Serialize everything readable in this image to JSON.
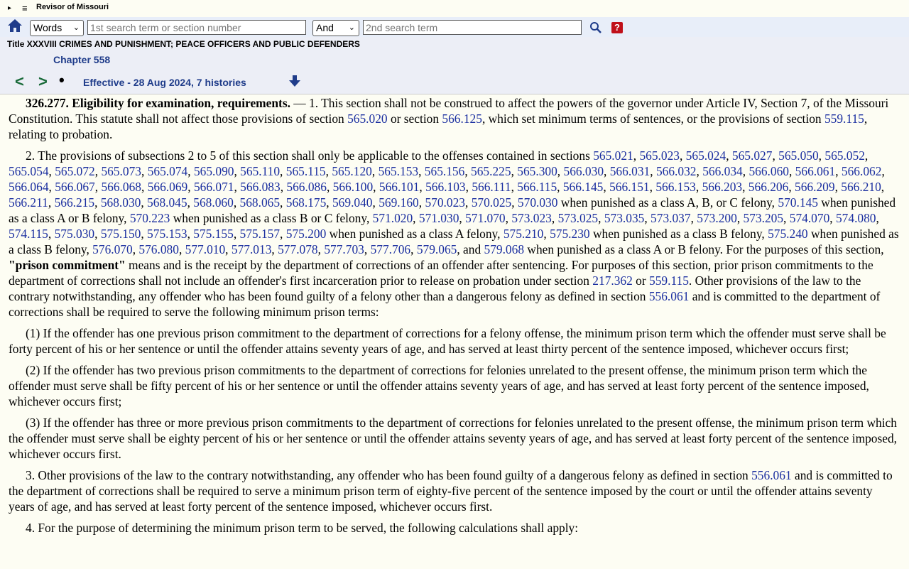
{
  "topbar": {
    "brand": "Revisor of Missouri",
    "triangle": "▸",
    "menu": "≡"
  },
  "search": {
    "mode_selected": "Words",
    "term1_placeholder": "1st search term or section number",
    "connector_selected": "And",
    "term2_placeholder": "2nd search term",
    "help_label": "?"
  },
  "header": {
    "title": "Title XXXVIII CRIMES AND PUNISHMENT; PEACE OFFICERS AND PUBLIC DEFENDERS",
    "chapter": "Chapter 558",
    "prev": "<",
    "next": ">",
    "dot": "•",
    "effective": "Effective - 28 Aug 2024, 7 histories"
  },
  "icons": {
    "home": "home-icon",
    "search": "search-icon",
    "help": "help-icon",
    "down": "down-arrow-icon"
  },
  "colors": {
    "link": "#1b2fa0",
    "chapter": "#1f3c8a",
    "nav": "#1a6b3a",
    "help_bg": "#c0101a"
  },
  "section": {
    "number": "326.277.",
    "heading": "Eligibility for examination, requirements.",
    "p1": [
      {
        "t": " — 1.  This section shall not be construed to affect the powers of the governor under Article IV, Section 7, of the Missouri Constitution.  This statute shall not affect those provisions of section "
      },
      {
        "t": "565.020",
        "link": true
      },
      {
        "t": " or section "
      },
      {
        "t": "566.125",
        "link": true
      },
      {
        "t": ", which set minimum terms of sentences, or the provisions of section "
      },
      {
        "t": "559.115",
        "link": true
      },
      {
        "t": ", relating to probation."
      }
    ],
    "p2": [
      {
        "t": "2.  The provisions of subsections 2 to 5 of this section shall only be applicable to the offenses contained in sections "
      },
      {
        "t": "565.021",
        "link": true
      },
      {
        "t": ", "
      },
      {
        "t": "565.023",
        "link": true
      },
      {
        "t": ", "
      },
      {
        "t": "565.024",
        "link": true
      },
      {
        "t": ", "
      },
      {
        "t": "565.027",
        "link": true
      },
      {
        "t": ", "
      },
      {
        "t": "565.050",
        "link": true
      },
      {
        "t": ", "
      },
      {
        "t": "565.052",
        "link": true
      },
      {
        "t": ", "
      },
      {
        "t": "565.054",
        "link": true
      },
      {
        "t": ", "
      },
      {
        "t": "565.072",
        "link": true
      },
      {
        "t": ", "
      },
      {
        "t": "565.073",
        "link": true
      },
      {
        "t": ", "
      },
      {
        "t": "565.074",
        "link": true
      },
      {
        "t": ", "
      },
      {
        "t": "565.090",
        "link": true
      },
      {
        "t": ", "
      },
      {
        "t": "565.110",
        "link": true
      },
      {
        "t": ", "
      },
      {
        "t": "565.115",
        "link": true
      },
      {
        "t": ", "
      },
      {
        "t": "565.120",
        "link": true
      },
      {
        "t": ", "
      },
      {
        "t": "565.153",
        "link": true
      },
      {
        "t": ", "
      },
      {
        "t": "565.156",
        "link": true
      },
      {
        "t": ", "
      },
      {
        "t": "565.225",
        "link": true
      },
      {
        "t": ", "
      },
      {
        "t": "565.300",
        "link": true
      },
      {
        "t": ", "
      },
      {
        "t": "566.030",
        "link": true
      },
      {
        "t": ", "
      },
      {
        "t": "566.031",
        "link": true
      },
      {
        "t": ", "
      },
      {
        "t": "566.032",
        "link": true
      },
      {
        "t": ", "
      },
      {
        "t": "566.034",
        "link": true
      },
      {
        "t": ", "
      },
      {
        "t": "566.060",
        "link": true
      },
      {
        "t": ", "
      },
      {
        "t": "566.061",
        "link": true
      },
      {
        "t": ", "
      },
      {
        "t": "566.062",
        "link": true
      },
      {
        "t": ", "
      },
      {
        "t": "566.064",
        "link": true
      },
      {
        "t": ", "
      },
      {
        "t": "566.067",
        "link": true
      },
      {
        "t": ", "
      },
      {
        "t": "566.068",
        "link": true
      },
      {
        "t": ", "
      },
      {
        "t": "566.069",
        "link": true
      },
      {
        "t": ", "
      },
      {
        "t": "566.071",
        "link": true
      },
      {
        "t": ", "
      },
      {
        "t": "566.083",
        "link": true
      },
      {
        "t": ", "
      },
      {
        "t": "566.086",
        "link": true
      },
      {
        "t": ", "
      },
      {
        "t": "566.100",
        "link": true
      },
      {
        "t": ", "
      },
      {
        "t": "566.101",
        "link": true
      },
      {
        "t": ", "
      },
      {
        "t": "566.103",
        "link": true
      },
      {
        "t": ", "
      },
      {
        "t": "566.111",
        "link": true
      },
      {
        "t": ", "
      },
      {
        "t": "566.115",
        "link": true
      },
      {
        "t": ", "
      },
      {
        "t": "566.145",
        "link": true
      },
      {
        "t": ", "
      },
      {
        "t": "566.151",
        "link": true
      },
      {
        "t": ", "
      },
      {
        "t": "566.153",
        "link": true
      },
      {
        "t": ", "
      },
      {
        "t": "566.203",
        "link": true
      },
      {
        "t": ", "
      },
      {
        "t": "566.206",
        "link": true
      },
      {
        "t": ", "
      },
      {
        "t": "566.209",
        "link": true
      },
      {
        "t": ", "
      },
      {
        "t": "566.210",
        "link": true
      },
      {
        "t": ", "
      },
      {
        "t": "566.211",
        "link": true
      },
      {
        "t": ", "
      },
      {
        "t": "566.215",
        "link": true
      },
      {
        "t": ", "
      },
      {
        "t": "568.030",
        "link": true
      },
      {
        "t": ", "
      },
      {
        "t": "568.045",
        "link": true
      },
      {
        "t": ", "
      },
      {
        "t": "568.060",
        "link": true
      },
      {
        "t": ", "
      },
      {
        "t": "568.065",
        "link": true
      },
      {
        "t": ", "
      },
      {
        "t": "568.175",
        "link": true
      },
      {
        "t": ", "
      },
      {
        "t": "569.040",
        "link": true
      },
      {
        "t": ", "
      },
      {
        "t": "569.160",
        "link": true
      },
      {
        "t": ", "
      },
      {
        "t": "570.023",
        "link": true
      },
      {
        "t": ", "
      },
      {
        "t": "570.025",
        "link": true
      },
      {
        "t": ", "
      },
      {
        "t": "570.030",
        "link": true
      },
      {
        "t": " when punished as a class A, B, or C felony, "
      },
      {
        "t": "570.145",
        "link": true
      },
      {
        "t": " when punished as a class A or B felony, "
      },
      {
        "t": "570.223",
        "link": true
      },
      {
        "t": " when punished as a class B or C felony, "
      },
      {
        "t": "571.020",
        "link": true
      },
      {
        "t": ", "
      },
      {
        "t": "571.030",
        "link": true
      },
      {
        "t": ", "
      },
      {
        "t": "571.070",
        "link": true
      },
      {
        "t": ", "
      },
      {
        "t": "573.023",
        "link": true
      },
      {
        "t": ", "
      },
      {
        "t": "573.025",
        "link": true
      },
      {
        "t": ", "
      },
      {
        "t": "573.035",
        "link": true
      },
      {
        "t": ", "
      },
      {
        "t": "573.037",
        "link": true
      },
      {
        "t": ", "
      },
      {
        "t": "573.200",
        "link": true
      },
      {
        "t": ", "
      },
      {
        "t": "573.205",
        "link": true
      },
      {
        "t": ", "
      },
      {
        "t": "574.070",
        "link": true
      },
      {
        "t": ", "
      },
      {
        "t": "574.080",
        "link": true
      },
      {
        "t": ", "
      },
      {
        "t": "574.115",
        "link": true
      },
      {
        "t": ", "
      },
      {
        "t": "575.030",
        "link": true
      },
      {
        "t": ", "
      },
      {
        "t": "575.150",
        "link": true
      },
      {
        "t": ", "
      },
      {
        "t": "575.153",
        "link": true
      },
      {
        "t": ", "
      },
      {
        "t": "575.155",
        "link": true
      },
      {
        "t": ", "
      },
      {
        "t": "575.157",
        "link": true
      },
      {
        "t": ", "
      },
      {
        "t": "575.200",
        "link": true
      },
      {
        "t": " when punished as a class A felony, "
      },
      {
        "t": "575.210",
        "link": true
      },
      {
        "t": ", "
      },
      {
        "t": "575.230",
        "link": true
      },
      {
        "t": " when punished as a class B felony, "
      },
      {
        "t": "575.240",
        "link": true
      },
      {
        "t": " when punished as a class B felony, "
      },
      {
        "t": "576.070",
        "link": true
      },
      {
        "t": ", "
      },
      {
        "t": "576.080",
        "link": true
      },
      {
        "t": ", "
      },
      {
        "t": "577.010",
        "link": true
      },
      {
        "t": ", "
      },
      {
        "t": "577.013",
        "link": true
      },
      {
        "t": ", "
      },
      {
        "t": "577.078",
        "link": true
      },
      {
        "t": ", "
      },
      {
        "t": "577.703",
        "link": true
      },
      {
        "t": ", "
      },
      {
        "t": "577.706",
        "link": true
      },
      {
        "t": ", "
      },
      {
        "t": "579.065",
        "link": true
      },
      {
        "t": ", and "
      },
      {
        "t": "579.068",
        "link": true
      },
      {
        "t": " when punished as a class A or B felony.  For the purposes of this section, "
      },
      {
        "t": "\"prison commitment\"",
        "bold": true
      },
      {
        "t": " means and is the receipt by the department of corrections of an offender after sentencing.  For purposes of this section, prior prison commitments to the department of corrections shall not include an offender's first incarceration prior to release on probation under section "
      },
      {
        "t": "217.362",
        "link": true
      },
      {
        "t": " or "
      },
      {
        "t": "559.115",
        "link": true
      },
      {
        "t": ".  Other provisions of the law to the contrary notwithstanding, any offender who has been found guilty of a felony other than a dangerous felony as defined in section "
      },
      {
        "t": "556.061",
        "link": true
      },
      {
        "t": " and is committed to the department of corrections shall be required to serve the following minimum prison terms:"
      }
    ],
    "p3": "(1)  If the offender has one previous prison commitment to the department of corrections for a felony offense, the minimum prison term which the offender must serve shall be forty percent of his or her sentence or until the offender attains seventy years of age, and has served at least thirty percent of the sentence imposed, whichever occurs first;",
    "p4": "(2)  If the offender has two previous prison commitments to the department of corrections for felonies unrelated to the present offense, the minimum prison term which the offender must serve shall be fifty percent of his or her sentence or until the offender attains seventy years of age, and has served at least forty percent of the sentence imposed, whichever occurs first;",
    "p5": "(3)  If the offender has three or more previous prison commitments to the department of corrections for felonies unrelated to the present offense, the minimum prison term which the offender must serve shall be eighty percent of his or her sentence or until the offender attains seventy years of age, and has served at least forty percent of the sentence imposed, whichever occurs first.",
    "p6": [
      {
        "t": "3.  Other provisions of the law to the contrary notwithstanding, any offender who has been found guilty of a dangerous felony as defined in section "
      },
      {
        "t": "556.061",
        "link": true
      },
      {
        "t": " and is committed to the department of corrections shall be required to serve a minimum prison term of eighty-five percent of the sentence imposed by the court or until the offender attains seventy years of age, and has served at least forty percent of the sentence imposed, whichever occurs first."
      }
    ],
    "p7": "4.  For the purpose of determining the minimum prison term to be served, the following calculations shall apply:"
  }
}
